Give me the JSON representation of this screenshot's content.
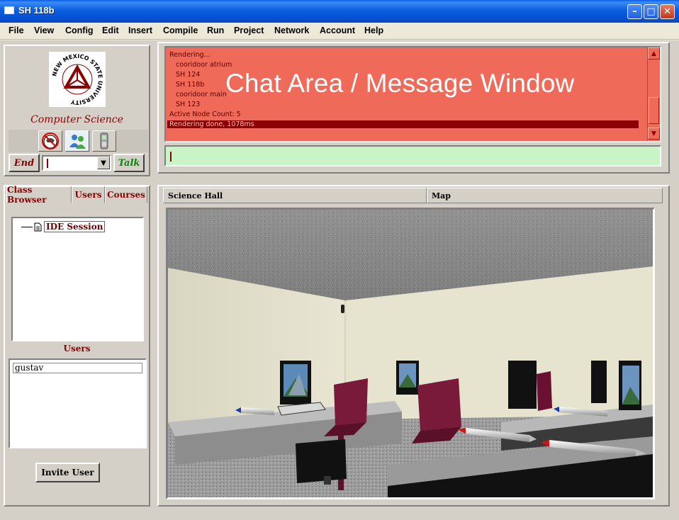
{
  "window": {
    "title": "SH 118b"
  },
  "menu": [
    "File",
    "View",
    "Config",
    "Edit",
    "Insert",
    "Compile",
    "Run",
    "Project",
    "Network",
    "Account",
    "Help"
  ],
  "logo": {
    "text": "NEW MEXICO STATE UNIVERSITY",
    "department": "Computer Science"
  },
  "controls": {
    "end_label": "End",
    "talk_label": "Talk",
    "combo_value": ""
  },
  "left_tabs": [
    {
      "label": "Class Browser"
    },
    {
      "label": "Users",
      "active": true
    },
    {
      "label": "Courses"
    }
  ],
  "tree": {
    "root": "IDE Session"
  },
  "users": {
    "heading": "Users",
    "list": [
      "gustav"
    ],
    "invite_label": "Invite User"
  },
  "chat": {
    "lines": [
      "Rendering...",
      "cooridoor atrium",
      "SH 124",
      "SH 118b",
      "cooridoor main",
      "SH 123",
      "Active Node Count: 5",
      "Rendering done, 1078ms"
    ],
    "overlay": "Chat Area / Message Window",
    "input_value": ""
  },
  "view_tabs": [
    {
      "label": "Science Hall",
      "active": true
    },
    {
      "label": "Map"
    }
  ],
  "colors": {
    "chat_bg": "#f06a5a",
    "chat_selected": "#8b0000",
    "input_bg": "#c8f4c8",
    "accent_red": "#8b0000",
    "accent_green": "#0a8a0a"
  }
}
